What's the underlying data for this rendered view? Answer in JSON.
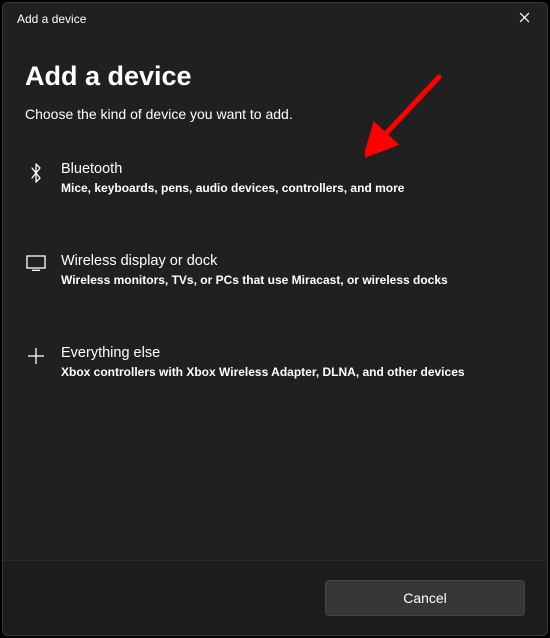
{
  "window": {
    "titlebar_title": "Add a device"
  },
  "header": {
    "heading": "Add a device",
    "subheading": "Choose the kind of device you want to add."
  },
  "options": [
    {
      "icon": "bluetooth-icon",
      "title": "Bluetooth",
      "desc": "Mice, keyboards, pens, audio devices, controllers, and more"
    },
    {
      "icon": "display-icon",
      "title": "Wireless display or dock",
      "desc": "Wireless monitors, TVs, or PCs that use Miracast, or wireless docks"
    },
    {
      "icon": "plus-icon",
      "title": "Everything else",
      "desc": "Xbox controllers with Xbox Wireless Adapter, DLNA, and other devices"
    }
  ],
  "footer": {
    "cancel_label": "Cancel"
  },
  "annotation": {
    "arrow_color": "#ff0000"
  }
}
